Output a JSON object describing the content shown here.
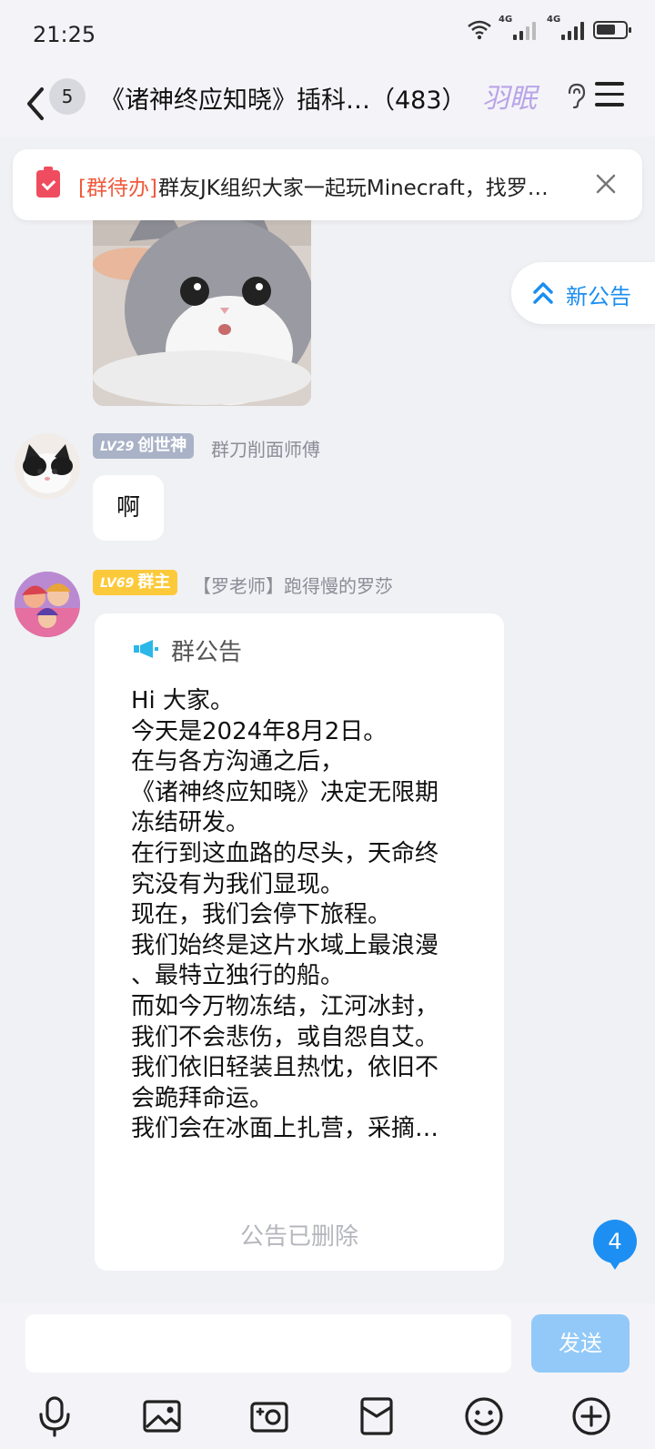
{
  "status_bar": {
    "time": "21:25",
    "network_1": "4G",
    "network_2": "4G"
  },
  "header": {
    "unread_count": "5",
    "title": "《诸神终应知晓》插科…（483）",
    "icons": [
      "back-icon",
      "ear-icon",
      "menu-icon"
    ]
  },
  "todo_banner": {
    "tag": "[群待办]",
    "text": "群友JK组织大家一起玩Minecraft，找罗…"
  },
  "new_notice": {
    "label": "新公告"
  },
  "messages": [
    {
      "level": "LV29",
      "role": "创世神",
      "sender": "群刀削面师傅",
      "text": "啊"
    },
    {
      "level": "LV69",
      "role": "群主",
      "sender": "【罗老师】跑得慢的罗莎"
    }
  ],
  "notice_card": {
    "header": "群公告",
    "lines": [
      "Hi 大家。",
      "今天是2024年8月2日。",
      "在与各方沟通之后，",
      "《诸神终应知晓》决定无限期",
      "冻结研发。",
      "在行到这血路的尽头，天命终",
      "究没有为我们显现。",
      "现在，我们会停下旅程。",
      "我们始终是这片水域上最浪漫",
      "、最特立独行的船。",
      "而如今万物冻结，江河冰封，",
      "我们不会悲伤，或自怨自艾。",
      "我们依旧轻装且热忱，依旧不",
      "会跪拜命运。",
      "我们会在冰面上扎营，采摘…"
    ],
    "deleted_label": "公告已删除"
  },
  "unread_messages": "4",
  "input_bar": {
    "input_value": "",
    "send_label": "发送",
    "tools": [
      "microphone-icon",
      "image-icon",
      "camera-icon",
      "red-packet-icon",
      "emoji-icon",
      "plus-icon"
    ]
  },
  "colors": {
    "accent_blue": "#1d8ff2",
    "todo_red": "#ef5a3c",
    "owner_tag": "#fcc93a",
    "level_tag": "#a9b2c6"
  }
}
